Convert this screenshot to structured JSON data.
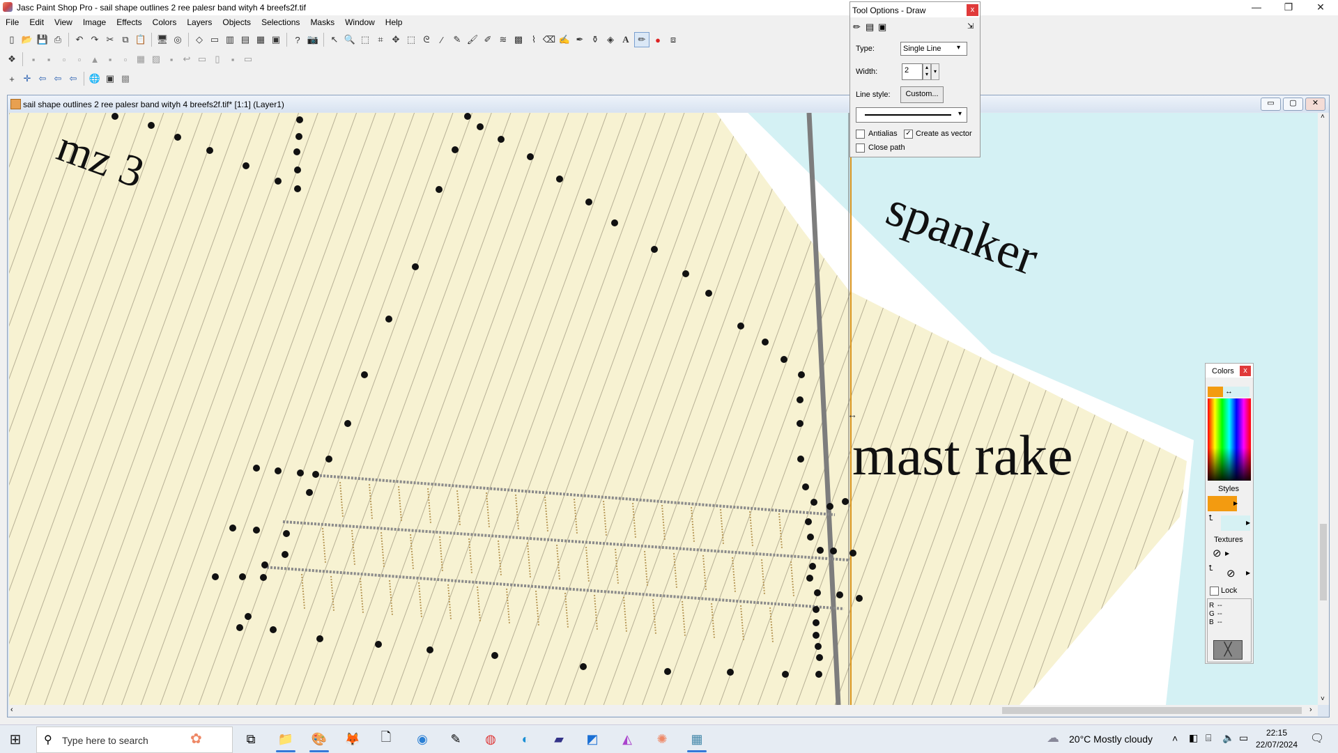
{
  "window": {
    "title": "Jasc Paint Shop Pro - sail shape outlines 2 ree  palesr  band  wityh 4 breefs2f.tif",
    "minimize": "—",
    "restore": "❐",
    "close": "✕"
  },
  "menu": [
    "File",
    "Edit",
    "View",
    "Image",
    "Effects",
    "Colors",
    "Layers",
    "Objects",
    "Selections",
    "Masks",
    "Window",
    "Help"
  ],
  "document": {
    "title": "sail shape outlines 2 ree  palesr  band  wityh 4 breefs2f.tif* [1:1] (Layer1)",
    "canvas_text": {
      "label1": "mz 3",
      "label2": "spanker",
      "label3": "mast rake"
    }
  },
  "tool_options": {
    "title": "Tool Options - Draw",
    "close": "x",
    "type_label": "Type:",
    "type_value": "Single Line",
    "width_label": "Width:",
    "width_value": "2",
    "line_style_label": "Line style:",
    "custom_button": "Custom...",
    "antialias_label": "Antialias",
    "antialias_checked": false,
    "create_vector_label": "Create as vector",
    "create_vector_checked": true,
    "close_path_label": "Close path",
    "close_path_checked": false
  },
  "colors_palette": {
    "title": "Colors",
    "close": "x",
    "styles_label": "Styles",
    "textures_label": "Textures",
    "lock_label": "Lock",
    "r_label": "R",
    "g_label": "G",
    "b_label": "B",
    "rgb_value": "--",
    "foreground_color": "#f39b10",
    "background_color": "#d6f1f3"
  },
  "taskbar": {
    "search_placeholder": "Type here to search",
    "weather": "20°C  Mostly cloudy",
    "time": "22:15",
    "date": "22/07/2024"
  }
}
